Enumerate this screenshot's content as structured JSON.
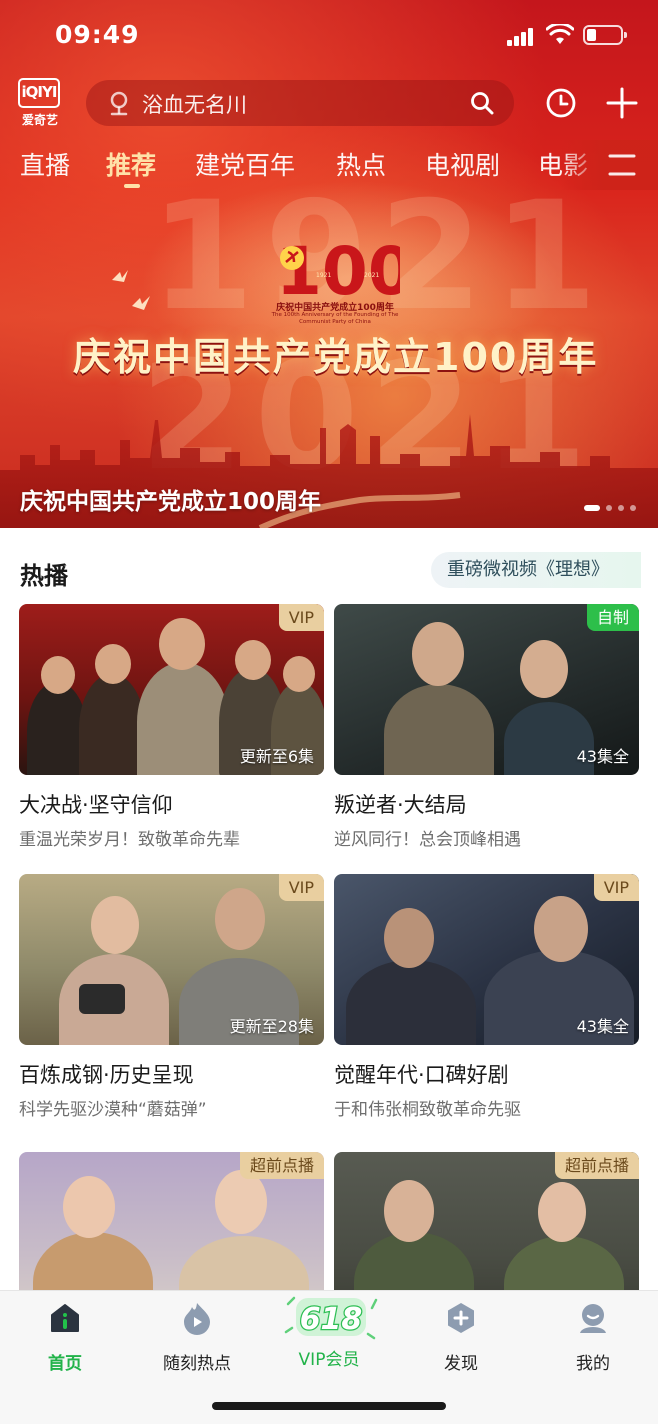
{
  "status_bar": {
    "time": "09:49"
  },
  "header": {
    "logo_text": "iQIYI",
    "logo_cn": "爱奇艺",
    "search_placeholder": "浴血无名川"
  },
  "tabs": [
    {
      "label": "直播"
    },
    {
      "label": "推荐",
      "active": true
    },
    {
      "label": "建党百年"
    },
    {
      "label": "热点"
    },
    {
      "label": "电视剧"
    },
    {
      "label": "电影"
    }
  ],
  "banner": {
    "emblem_number": "100",
    "emblem_year_left": "1921",
    "emblem_year_right": "2021",
    "emblem_cn": "庆祝中国共产党成立100周年",
    "emblem_en": "The 100th Anniversary of the Founding of The Communist Party of China",
    "headline": "庆祝中国共产党成立100周年",
    "title": "庆祝中国共产党成立100周年",
    "bg_year_top": "1921",
    "bg_year_bottom": "2021"
  },
  "section": {
    "title": "热播",
    "promo": "重磅微视频《理想》"
  },
  "cards": [
    {
      "badge": "VIP",
      "badge_type": "vip",
      "episodes": "更新至6集",
      "title": "大决战·坚守信仰",
      "subtitle": "重温光荣岁月！致敬革命先辈"
    },
    {
      "badge": "自制",
      "badge_type": "self",
      "episodes": "43集全",
      "title": "叛逆者·大结局",
      "subtitle": "逆风同行！总会顶峰相遇"
    },
    {
      "badge": "VIP",
      "badge_type": "vip",
      "episodes": "更新至28集",
      "title": "百炼成钢·历史呈现",
      "subtitle": "科学先驱沙漠种“蘑菇弹”"
    },
    {
      "badge": "VIP",
      "badge_type": "vip",
      "episodes": "43集全",
      "title": "觉醒年代·口碑好剧",
      "subtitle": "于和伟张桐致敬革命先驱"
    },
    {
      "badge": "超前点播",
      "badge_type": "pre",
      "episodes": "",
      "title": "",
      "subtitle": ""
    },
    {
      "badge": "超前点播",
      "badge_type": "pre",
      "episodes": "",
      "title": "",
      "subtitle": ""
    }
  ],
  "bottom_nav": [
    {
      "label": "首页",
      "icon": "home-icon",
      "active": true
    },
    {
      "label": "随刻热点",
      "icon": "flame-play-icon"
    },
    {
      "label": "VIP会员",
      "icon": "vip-618-icon",
      "badge": "618"
    },
    {
      "label": "发现",
      "icon": "discover-plus-icon"
    },
    {
      "label": "我的",
      "icon": "profile-icon"
    }
  ],
  "colors": {
    "brand_green": "#22b34a",
    "header_red": "#d9241c",
    "tab_active": "#ffe1a8",
    "vip_gold": "#e9cfa0"
  }
}
